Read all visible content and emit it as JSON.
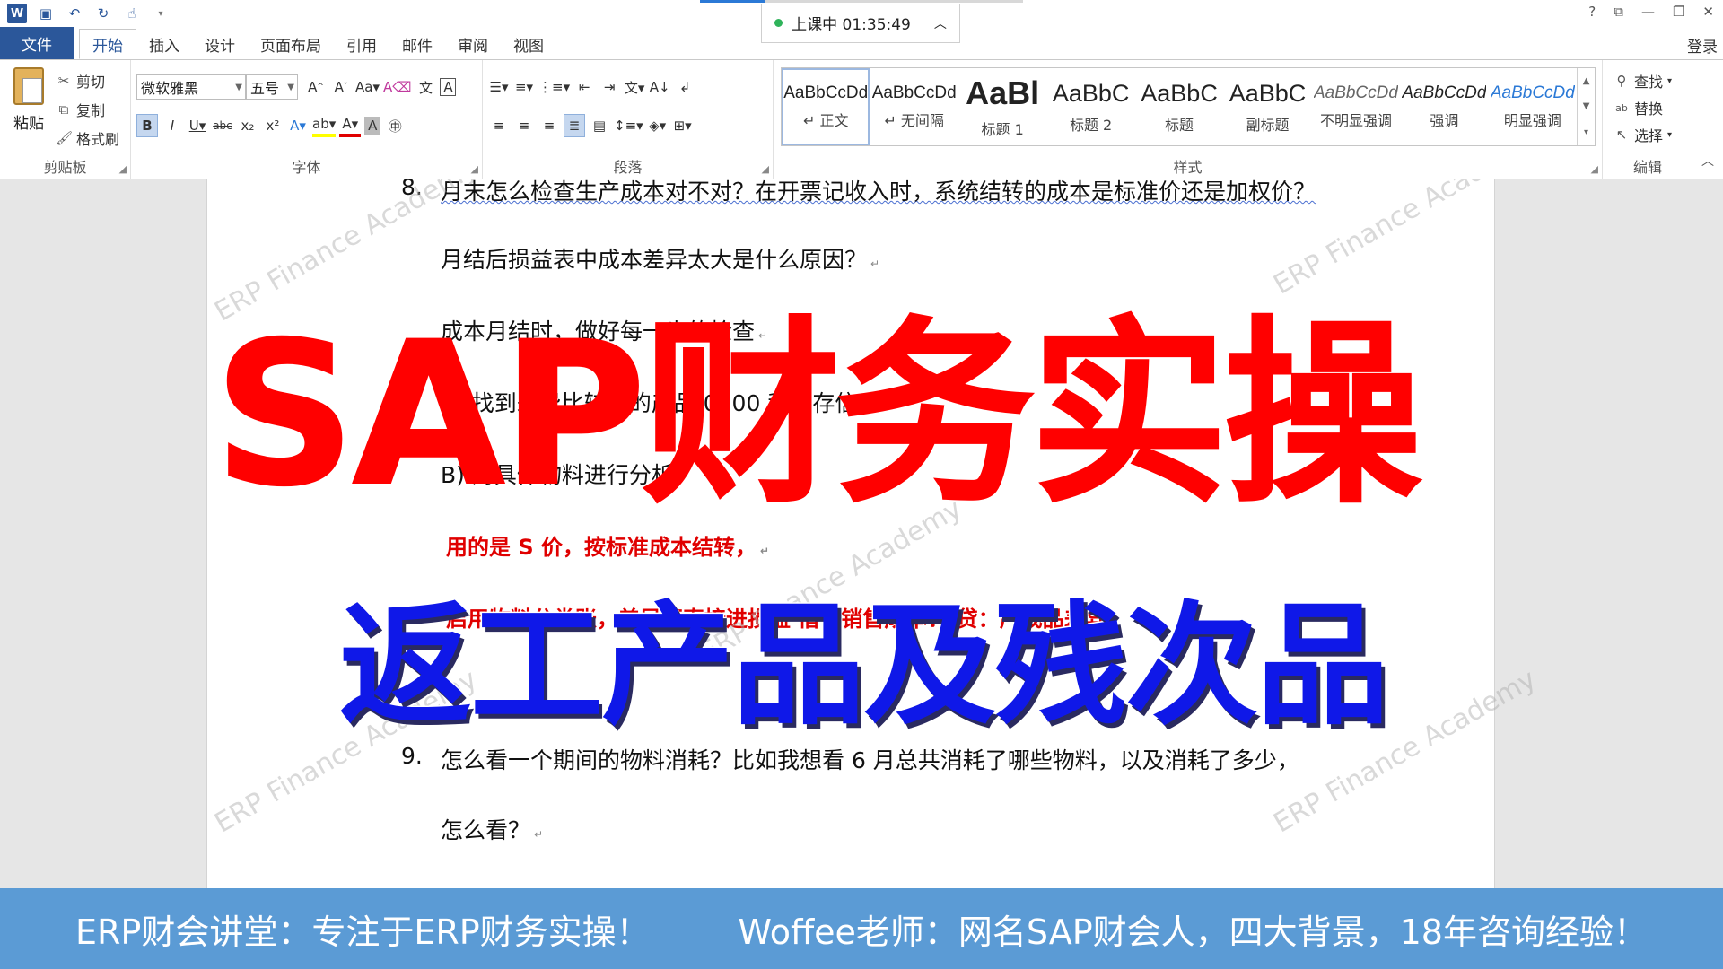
{
  "titlebar": {
    "class_status": "上课中 01:35:49",
    "winctrl_help": "?",
    "winctrl_restore_ribbon": "⧉",
    "winctrl_minimize": "—",
    "winctrl_maximize": "❐",
    "winctrl_close": "✕",
    "login": "登录"
  },
  "tabs": [
    "文件",
    "开始",
    "插入",
    "设计",
    "页面布局",
    "引用",
    "邮件",
    "审阅",
    "视图"
  ],
  "ribbon": {
    "clipboard": {
      "paste": "粘贴",
      "cut": "剪切",
      "copy": "复制",
      "format_painter": "格式刷",
      "label": "剪贴板"
    },
    "font": {
      "font_name": "微软雅黑",
      "font_size": "五号",
      "label": "字体"
    },
    "paragraph": {
      "label": "段落"
    },
    "styles": {
      "label": "样式",
      "items": [
        {
          "sample": "AaBbCcDd",
          "name": "↵ 正文"
        },
        {
          "sample": "AaBbCcDd",
          "name": "↵ 无间隔"
        },
        {
          "sample": "AaBl",
          "name": "标题 1"
        },
        {
          "sample": "AaBbC",
          "name": "标题 2"
        },
        {
          "sample": "AaBbC",
          "name": "标题"
        },
        {
          "sample": "AaBbC",
          "name": "副标题"
        },
        {
          "sample": "AaBbCcDd",
          "name": "不明显强调"
        },
        {
          "sample": "AaBbCcDd",
          "name": "强调"
        },
        {
          "sample": "AaBbCcDd",
          "name": "明显强调"
        }
      ]
    },
    "editing": {
      "find": "查找",
      "replace": "替换",
      "select": "选择",
      "label": "编辑"
    }
  },
  "document": {
    "q8_num": "8.",
    "q8_text": "月末怎么检查生产成本对不对？在开票记收入时，系统结转的成本是标准价还是加权价？",
    "line2": "月结后损益表中成本差异太大是什么原因？",
    "line3": "成本月结时，做好每一步的检查",
    "line4": "A) 找到差异比较大的产品  0000  和库存信",
    "line5": "B) 对具体物料进行分析",
    "line6": "用的是 S 价，按标准成本结转，",
    "line7": "启用物料分类账，差异不直接进损益    借：销售成本：    贷：产成品差异",
    "q9_num": "9.",
    "q9_text": "怎么看一个期间的物料消耗？比如我想看 6 月总共消耗了哪些物料，以及消耗了多少，",
    "line9": "怎么看？"
  },
  "watermark": "ERP Finance Academy",
  "overlay": {
    "title_red": "SAP财务实操",
    "title_blue": "返工产品及残次品"
  },
  "banner": {
    "left": "ERP财会讲堂：专注于ERP财务实操！",
    "right": "Woffee老师：网名SAP财会人，四大背景，18年咨询经验！"
  }
}
